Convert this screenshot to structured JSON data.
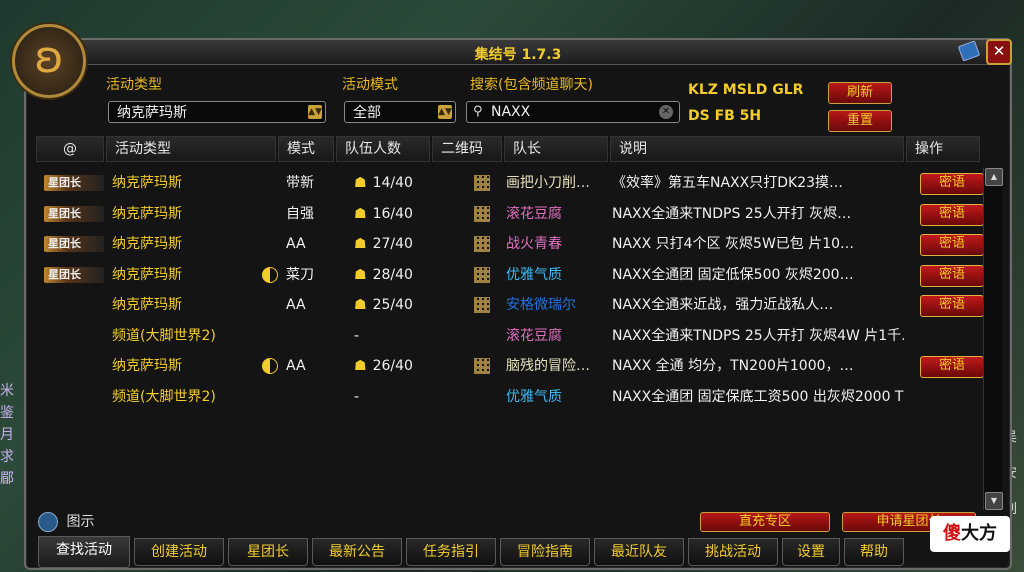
{
  "window": {
    "title": "集结号 1.7.3",
    "close_label": "✕"
  },
  "filters": {
    "activity_type_label": "活动类型",
    "activity_type_value": "纳克萨玛斯",
    "activity_mode_label": "活动模式",
    "activity_mode_value": "全部",
    "search_label": "搜索(包含频道聊天)",
    "search_value": "NAXX"
  },
  "tags": {
    "line1": "KLZ MSLD GLR",
    "line2": "DS FB 5H"
  },
  "buttons": {
    "refresh": "刷新",
    "reset": "重置",
    "recharge": "直充专区",
    "apply_leader": "申请星团长"
  },
  "columns": [
    "@",
    "活动类型",
    "模式",
    "队伍人数",
    "二维码",
    "队长",
    "说明",
    "操作"
  ],
  "rows": [
    {
      "badge": "星团长",
      "type": "纳克萨玛斯",
      "moon": false,
      "mode": "带新",
      "count": "14/40",
      "qr": true,
      "leader": "画把小刀削…",
      "leader_color": "#e8e0c0",
      "desc": "《效率》第五车NAXX只打DK23摸…",
      "action": "密语"
    },
    {
      "badge": "星团长",
      "type": "纳克萨玛斯",
      "moon": false,
      "mode": "自强",
      "count": "16/40",
      "qr": true,
      "leader": "滚花豆腐",
      "leader_color": "#e070c0",
      "desc": "NAXX全通来TNDPS 25人开打 灰烬…",
      "action": "密语"
    },
    {
      "badge": "星团长",
      "type": "纳克萨玛斯",
      "moon": false,
      "mode": "AA",
      "count": "27/40",
      "qr": true,
      "leader": "战火青春",
      "leader_color": "#e070c0",
      "desc": "NAXX 只打4个区 灰烬5W已包 片10…",
      "action": "密语"
    },
    {
      "badge": "星团长",
      "type": "纳克萨玛斯",
      "moon": true,
      "mode": "菜刀",
      "count": "28/40",
      "qr": true,
      "leader": "优雅气质",
      "leader_color": "#40b8f0",
      "desc": "NAXX全通团 固定低保500 灰烬200…",
      "action": "密语"
    },
    {
      "badge": "",
      "type": "纳克萨玛斯",
      "moon": false,
      "mode": "AA",
      "count": "25/40",
      "qr": true,
      "leader": "安格微瑞尔",
      "leader_color": "#2070e0",
      "desc": "NAXX全通来近战，强力近战私人…",
      "action": "密语"
    },
    {
      "badge": "",
      "type": "频道(大脚世界2)",
      "moon": false,
      "mode": "",
      "count": "-",
      "qr": false,
      "leader": "滚花豆腐",
      "leader_color": "#e070c0",
      "desc": "NAXX全通来TNDPS 25人开打 灰烬4W 片1千…",
      "action": ""
    },
    {
      "badge": "",
      "type": "纳克萨玛斯",
      "moon": true,
      "mode": "AA",
      "count": "26/40",
      "qr": true,
      "leader": "脑残的冒险…",
      "leader_color": "#e8e0c0",
      "desc": "NAXX 全通 均分，TN200片1000，…",
      "action": "密语"
    },
    {
      "badge": "",
      "type": "频道(大脚世界2)",
      "moon": false,
      "mode": "",
      "count": "-",
      "qr": false,
      "leader": "优雅气质",
      "leader_color": "#40b8f0",
      "desc": "NAXX全通团 固定保底工资500 出灰烬2000 T…",
      "action": ""
    }
  ],
  "legend_label": "图示",
  "tabs": [
    "查找活动",
    "创建活动",
    "星团长",
    "最新公告",
    "任务指引",
    "冒险指南",
    "最近队友",
    "挑战活动",
    "设置",
    "帮助"
  ],
  "background": {
    "left_text": [
      "米",
      "鉴",
      "月",
      "求",
      "郿"
    ],
    "right_text": [
      "吴",
      "安",
      "刘"
    ]
  },
  "watermark": {
    "first": "傻",
    "rest": "大方"
  }
}
